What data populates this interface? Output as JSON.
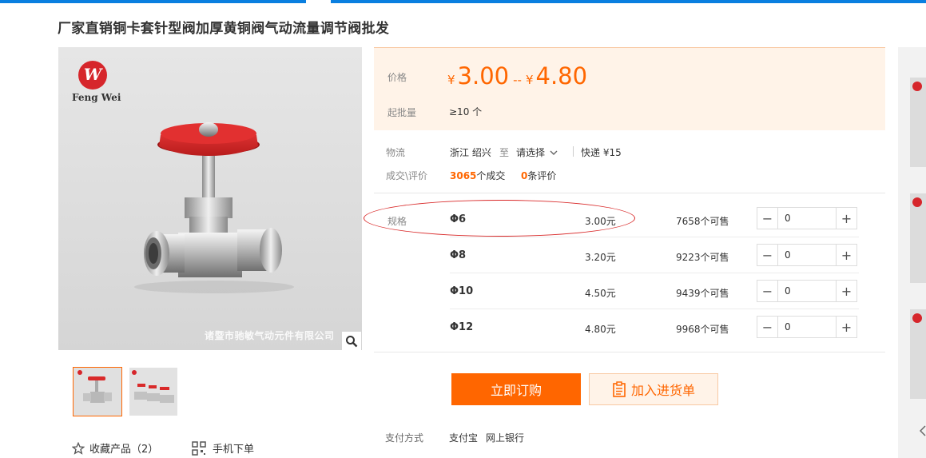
{
  "product": {
    "title": "厂家直销铜卡套针型阀加厚黄铜阀气动流量调节阀批发",
    "brand_logo_text": "Feng Wei",
    "brand_mark": "W",
    "watermark": "诸暨市驰敏气动元件有限公司"
  },
  "price": {
    "label": "价格",
    "currency": "¥",
    "low": "3.00",
    "separator": "--",
    "high": "4.80",
    "moq_label": "起批量",
    "moq_value": "≥10 个",
    "accent_color": "#ff6600"
  },
  "logistics": {
    "label": "物流",
    "origin": "浙江 绍兴",
    "to": "至",
    "destination": "请选择",
    "express": "快递 ¥15"
  },
  "deals": {
    "label": "成交\\评价",
    "count": "3065",
    "count_suffix": "个成交",
    "reviews": "0",
    "reviews_suffix": "条评价"
  },
  "sku": {
    "label": "规格",
    "rows": [
      {
        "name": "Φ6",
        "price": "3.00元",
        "stock": "7658个可售",
        "qty": "0"
      },
      {
        "name": "Φ8",
        "price": "3.20元",
        "stock": "9223个可售",
        "qty": "0"
      },
      {
        "name": "Φ10",
        "price": "4.50元",
        "stock": "9439个可售",
        "qty": "0"
      },
      {
        "name": "Φ12",
        "price": "4.80元",
        "stock": "9968个可售",
        "qty": "0"
      }
    ],
    "minus": "−",
    "plus": "+"
  },
  "actions": {
    "buy_now": "立即订购",
    "add_to_list": "加入进货单"
  },
  "payment": {
    "label": "支付方式",
    "methods": [
      "支付宝",
      "网上银行"
    ]
  },
  "footer_links": {
    "favorite": "收藏产品（2）",
    "mobile_order": "手机下单"
  },
  "icons": [
    "search-icon",
    "star-icon",
    "qrcode-icon",
    "clipboard-icon",
    "chevron-down-icon",
    "chevron-left-icon"
  ]
}
